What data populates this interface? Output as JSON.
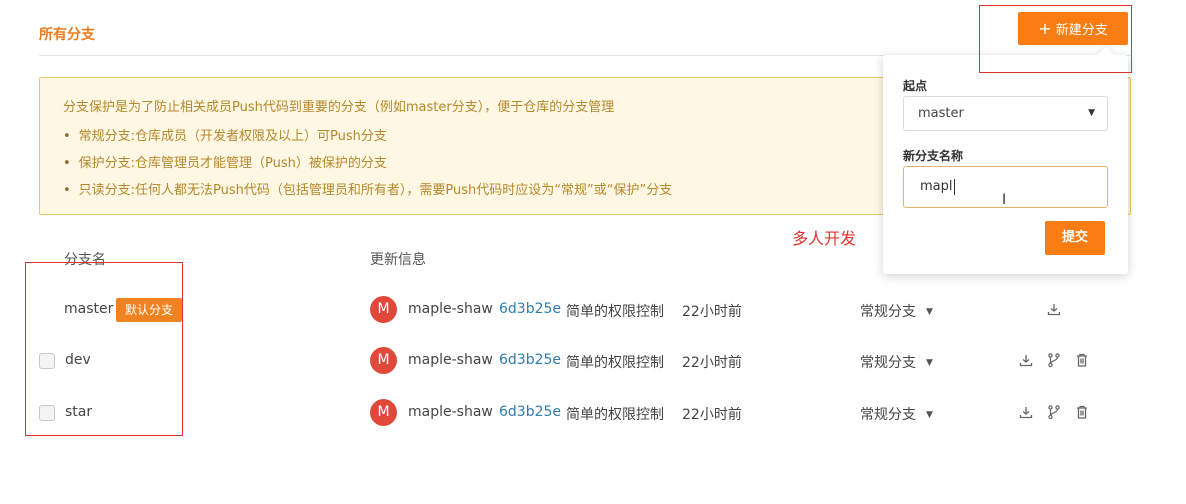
{
  "header": {
    "section_title": "所有分支",
    "new_branch_label": "新建分支",
    "new_branch_icon": "plus-icon"
  },
  "notice": {
    "intro": "分支保护是为了防止相关成员Push代码到重要的分支（例如master分支），便于仓库的分支管理",
    "items": [
      "常规分支:仓库成员（开发者权限及以上）可Push分支",
      "保护分支:仓库管理员才能管理（Push）被保护的分支",
      "只读分支:任何人都无法Push代码（包括管理员和所有者），需要Push代码时应设为“常规”或“保护”分支"
    ]
  },
  "table": {
    "columns": {
      "name": "分支名",
      "update": "更新信息"
    },
    "default_badge": "默认分支",
    "rows": [
      {
        "name": "master",
        "avatar": "M",
        "author": "maple-shaw",
        "commit": "6d3b25e",
        "message": "简单的权限控制",
        "time": "22小时前",
        "type": "常规分支"
      },
      {
        "name": "dev",
        "avatar": "M",
        "author": "maple-shaw",
        "commit": "6d3b25e",
        "message": "简单的权限控制",
        "time": "22小时前",
        "type": "常规分支"
      },
      {
        "name": "star",
        "avatar": "M",
        "author": "maple-shaw",
        "commit": "6d3b25e",
        "message": "简单的权限控制",
        "time": "22小时前",
        "type": "常规分支"
      }
    ]
  },
  "popover": {
    "origin_label": "起点",
    "origin_value": "master",
    "name_label": "新分支名称",
    "name_value": "mapl",
    "submit_label": "提交"
  },
  "annotation": {
    "text": "多人开发",
    "color": "#e0332f"
  },
  "colors": {
    "accent": "#f97d12",
    "notice_bg": "#fdf7e3",
    "notice_text": "#b6882c",
    "commit_link": "#2f7db0",
    "avatar": "#e0493a"
  }
}
